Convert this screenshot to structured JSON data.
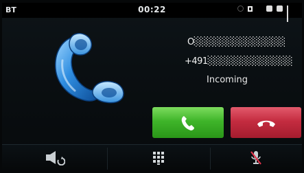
{
  "status_bar": {
    "left_label": "BT",
    "clock": "00:22"
  },
  "caller": {
    "name": "O░░░░░░░░░░░░░░",
    "number": "+491░░░░░░░░░░░░░",
    "state": "Incoming"
  },
  "colors": {
    "accept": "#3fb52a",
    "reject": "#c42c40",
    "handset": "#2f8de0"
  },
  "icons": {
    "accept": "phone-answer-icon",
    "reject": "phone-hangup-icon",
    "handset": "handset-icon",
    "speaker": "speaker-switch-icon",
    "keypad": "keypad-icon",
    "mic": "mic-mute-icon"
  }
}
